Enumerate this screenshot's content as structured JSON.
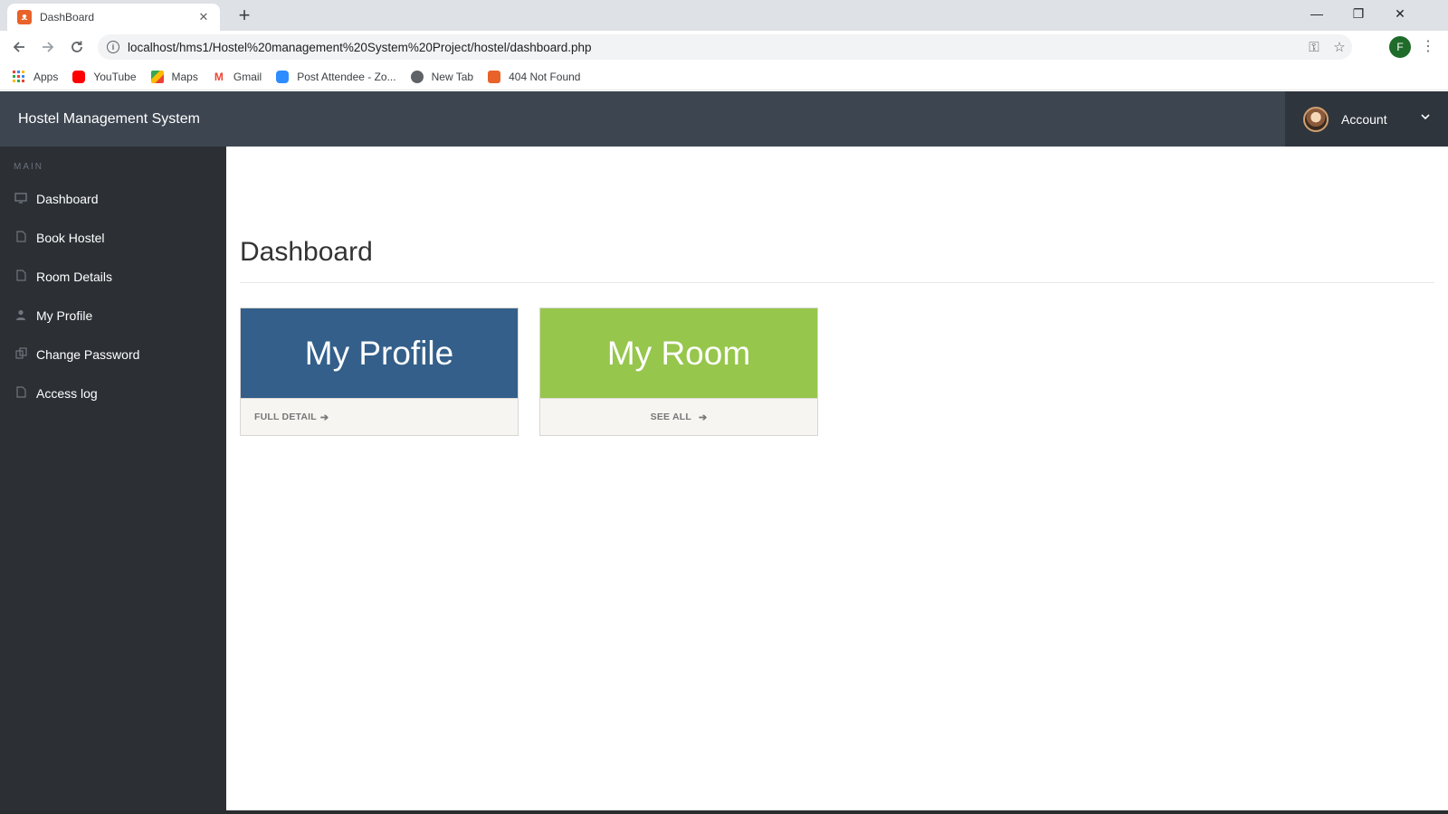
{
  "browser": {
    "tab_title": "DashBoard",
    "tab_close": "✕",
    "new_tab": "+",
    "url": "localhost/hms1/Hostel%20management%20System%20Project/hostel/dashboard.php",
    "profile_initial": "F",
    "window_controls": {
      "minimize": "—",
      "restore": "❐",
      "close": "✕"
    },
    "bookmarks": [
      {
        "label": "Apps",
        "icon": "apps-grid-icon"
      },
      {
        "label": "YouTube",
        "icon": "youtube-icon"
      },
      {
        "label": "Maps",
        "icon": "maps-icon"
      },
      {
        "label": "Gmail",
        "icon": "gmail-icon"
      },
      {
        "label": "Post Attendee - Zo...",
        "icon": "zoom-icon"
      },
      {
        "label": "New Tab",
        "icon": "globe-icon"
      },
      {
        "label": "404 Not Found",
        "icon": "xampp-icon"
      }
    ]
  },
  "header": {
    "brand": "Hostel Management System",
    "account_label": "Account"
  },
  "sidebar": {
    "heading": "MAIN",
    "items": [
      {
        "label": "Dashboard",
        "icon": "desktop-icon"
      },
      {
        "label": "Book Hostel",
        "icon": "file-icon"
      },
      {
        "label": "Room Details",
        "icon": "file-icon"
      },
      {
        "label": "My Profile",
        "icon": "user-icon"
      },
      {
        "label": "Change Password",
        "icon": "copy-icon"
      },
      {
        "label": "Access log",
        "icon": "file-icon"
      }
    ]
  },
  "main": {
    "title": "Dashboard",
    "cards": [
      {
        "title": "My Profile",
        "link": "FULL DETAIL",
        "color": "#335f8a"
      },
      {
        "title": "My Room",
        "link": "SEE ALL",
        "color": "#96c64c"
      }
    ]
  },
  "colors": {
    "header_bg": "#3d4550",
    "sidebar_bg": "#2c3035",
    "account_bg": "#2f353d"
  }
}
